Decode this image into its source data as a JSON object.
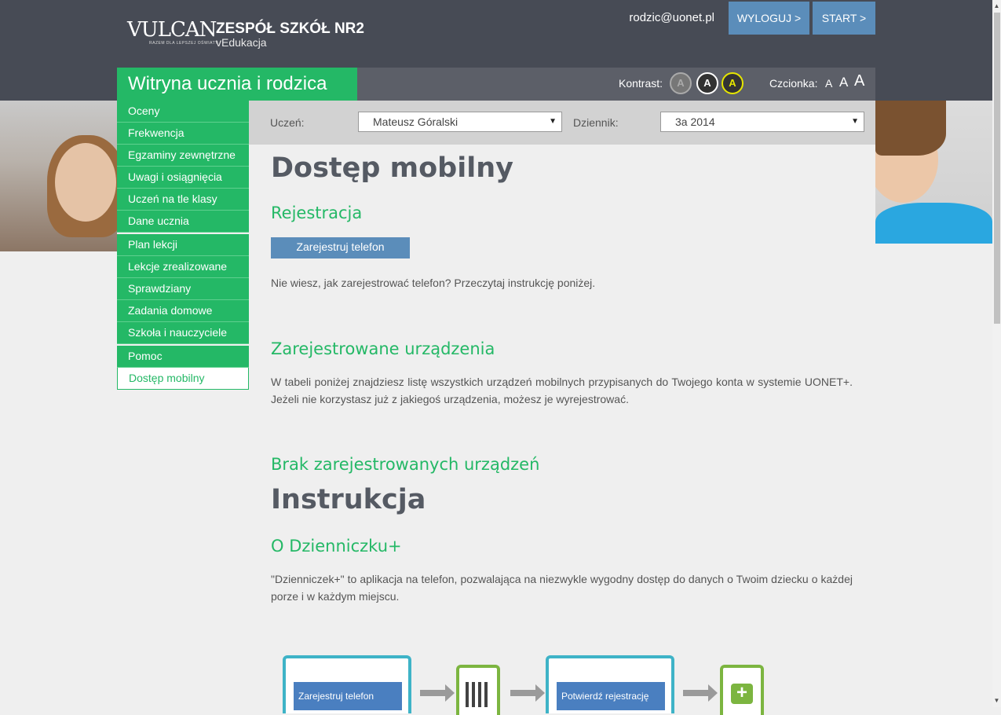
{
  "header": {
    "logo_text": "VULCAN",
    "logo_tagline": "RAZEM DLA LEPSZEJ OŚWIATY",
    "school_name": "ZESPÓŁ SZKÓŁ NR2",
    "school_sub": "vEdukacja",
    "user_email": "rodzic@uonet.pl",
    "logout_label": "WYLOGUJ >",
    "start_label": "START >"
  },
  "site_title": "Witryna ucznia i rodzica",
  "accessibility": {
    "contrast_label": "Kontrast:",
    "contrast_options": [
      "A",
      "A",
      "A"
    ],
    "font_label": "Czcionka:",
    "font_sizes": [
      "A",
      "A",
      "A"
    ]
  },
  "sidebar": {
    "items": [
      {
        "label": "Oceny"
      },
      {
        "label": "Frekwencja"
      },
      {
        "label": "Egzaminy zewnętrzne"
      },
      {
        "label": "Uwagi i osiągnięcia"
      },
      {
        "label": "Uczeń na tle klasy"
      },
      {
        "label": "Dane ucznia"
      },
      {
        "label": "Plan lekcji"
      },
      {
        "label": "Lekcje zrealizowane"
      },
      {
        "label": "Sprawdziany"
      },
      {
        "label": "Zadania domowe"
      },
      {
        "label": "Szkoła i nauczyciele"
      },
      {
        "label": "Pomoc"
      },
      {
        "label": "Dostęp mobilny"
      }
    ],
    "active": "Dostęp mobilny"
  },
  "filters": {
    "student_label": "Uczeń:",
    "student_value": "Mateusz Góralski",
    "journal_label": "Dziennik:",
    "journal_value": "3a 2014"
  },
  "main": {
    "page_title": "Dostęp mobilny",
    "registration_heading": "Rejestracja",
    "register_button": "Zarejestruj telefon",
    "registration_help": "Nie wiesz, jak zarejestrować telefon? Przeczytaj instrukcję poniżej.",
    "devices_heading": "Zarejestrowane urządzenia",
    "devices_text": "W tabeli poniżej znajdziesz listę wszystkich urządzeń mobilnych przypisanych do Twojego konta w systemie UONET+. Jeżeli nie korzystasz już z jakiegoś urządzenia, możesz je wyrejestrować.",
    "no_devices_heading": "Brak zarejestrowanych urządzeń",
    "instruction_title": "Instrukcja",
    "about_heading": "O Dzienniczku+",
    "about_text": "\"Dzienniczek+\" to aplikacja na telefon, pozwalająca na niezwykle wygodny dostęp do danych o Twoim dziecku o każdej porze i w każdym miejscu."
  },
  "illustration": {
    "step1_label": "Zarejestruj telefon",
    "step3_label": "Potwierdź rejestrację",
    "accent_tablet": "#3eb3c7",
    "accent_phone": "#7cb540"
  },
  "colors": {
    "brand_green": "#24b866",
    "button_blue": "#5b8dba",
    "header_dark": "#474b55"
  }
}
